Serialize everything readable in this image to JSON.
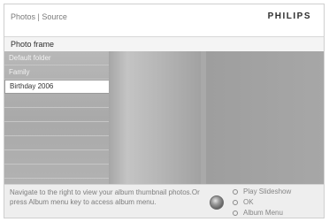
{
  "header": {
    "breadcrumb": "Photos | Source",
    "brand": "PHILIPS"
  },
  "section_title": "Photo frame",
  "albums": [
    {
      "label": "Default folder",
      "selected": false
    },
    {
      "label": "Family",
      "selected": false
    },
    {
      "label": "Birthday 2006",
      "selected": true
    },
    {
      "label": "",
      "selected": false
    },
    {
      "label": "",
      "selected": false
    },
    {
      "label": "",
      "selected": false
    },
    {
      "label": "",
      "selected": false
    },
    {
      "label": "",
      "selected": false
    },
    {
      "label": "",
      "selected": false
    }
  ],
  "footer": {
    "help_text": "Navigate to the right to view your album thumbnail photos.Or press Album menu key to access album menu.",
    "options": [
      {
        "label": "Play Slideshow",
        "icon": "circle-outline-icon"
      },
      {
        "label": "OK",
        "icon": "circle-outline-icon"
      },
      {
        "label": "Album Menu",
        "icon": "circle-outline-icon"
      }
    ]
  },
  "colors": {
    "panel": "#a9a9a9",
    "selected_row": "#ffffff",
    "footer": "#eeeeee"
  }
}
